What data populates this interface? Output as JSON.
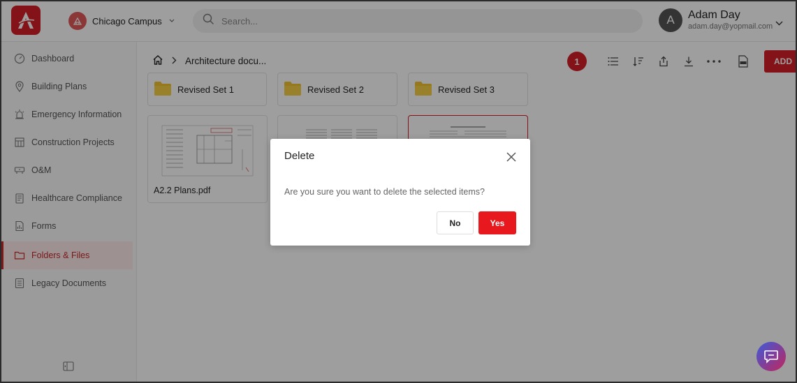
{
  "header": {
    "campus": "Chicago Campus",
    "search_placeholder": "Search...",
    "user_initial": "A",
    "user_name": "Adam Day",
    "user_email": "adam.day@yopmail.com"
  },
  "sidebar": {
    "items": [
      {
        "label": "Dashboard",
        "icon": "gauge-icon"
      },
      {
        "label": "Building Plans",
        "icon": "map-pin-icon"
      },
      {
        "label": "Emergency Information",
        "icon": "alarm-icon"
      },
      {
        "label": "Construction Projects",
        "icon": "crane-icon"
      },
      {
        "label": "O&M",
        "icon": "tools-icon"
      },
      {
        "label": "Healthcare Compliance",
        "icon": "clipboard-icon"
      },
      {
        "label": "Forms",
        "icon": "form-icon"
      },
      {
        "label": "Folders & Files",
        "icon": "folder-icon",
        "active": true
      },
      {
        "label": "Legacy Documents",
        "icon": "documents-icon"
      }
    ]
  },
  "main": {
    "breadcrumb": "Architecture docu...",
    "selected_count": "1",
    "add_label": "ADD",
    "folders": [
      "Revised Set 1",
      "Revised Set 2",
      "Revised Set 3"
    ],
    "files": [
      {
        "name": "A2.2 Plans.pdf"
      },
      {
        "name": ""
      },
      {
        "name": ""
      }
    ]
  },
  "modal": {
    "title": "Delete",
    "message": "Are you sure you want to delete the selected items?",
    "no_label": "No",
    "yes_label": "Yes"
  },
  "colors": {
    "brand": "#d42027",
    "active_bg": "#fdeaea"
  }
}
